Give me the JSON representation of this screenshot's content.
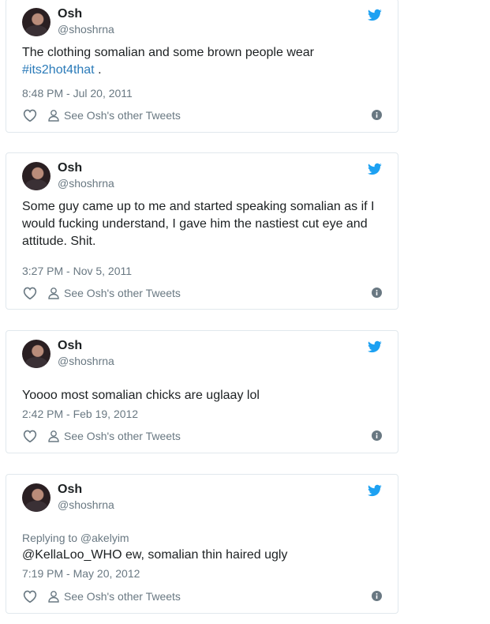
{
  "tweets": [
    {
      "name": "Osh",
      "handle": "@shoshrna",
      "text": "The clothing somalian and some brown people wear",
      "hashtag": "#its2hot4that",
      "text_suffix": " .",
      "time": "8:48 PM - Jul 20, 2011",
      "see_more": "See Osh's other Tweets"
    },
    {
      "name": "Osh",
      "handle": "@shoshrna",
      "text": "Some guy came up to me and started speaking somalian as if I would fucking understand, I gave him the nastiest cut eye and attitude. Shit.",
      "time": "3:27 PM - Nov 5, 2011",
      "see_more": "See Osh's other Tweets"
    },
    {
      "name": "Osh",
      "handle": "@shoshrna",
      "text": "Yoooo most somalian chicks are uglaay lol",
      "time": "2:42 PM - Feb 19, 2012",
      "see_more": "See Osh's other Tweets"
    },
    {
      "name": "Osh",
      "handle": "@shoshrna",
      "reply_to": "Replying to @akelyim",
      "text": "@KellaLoo_WHO ew, somalian thin haired ugly",
      "time": "7:19 PM - May 20, 2012",
      "see_more": "See Osh's other Tweets"
    }
  ],
  "icons": {
    "bird": "twitter-bird-icon",
    "heart": "heart-icon",
    "user": "user-icon",
    "info": "info-icon"
  },
  "colors": {
    "twitter_blue": "#1da1f2",
    "link_blue": "#2b7bb9",
    "muted": "#697882",
    "border": "#e1e8ed"
  }
}
